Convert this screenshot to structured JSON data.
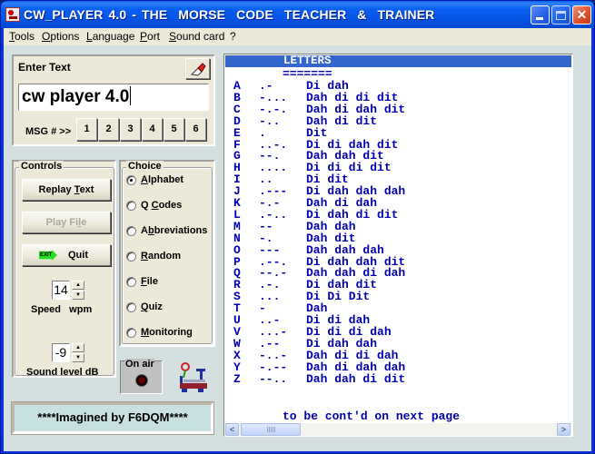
{
  "window": {
    "title": "CW_PLAYER 4.0 - THE  MORSE  CODE  TEACHER  &  TRAINER",
    "minimize_label": "Minimize",
    "maximize_label": "Maximize",
    "close_label": "Close"
  },
  "menu": [
    {
      "label": "Tools",
      "mnemonic": "T",
      "rest": "ools"
    },
    {
      "label": "Options",
      "mnemonic": "O",
      "rest": "ptions"
    },
    {
      "label": "Language",
      "mnemonic": "L",
      "rest": "anguage"
    },
    {
      "label": "Port",
      "mnemonic": "P",
      "rest": "ort"
    },
    {
      "label": "Sound card",
      "mnemonic": "S",
      "rest": "ound card"
    },
    {
      "label": "?",
      "mnemonic": "",
      "rest": "?"
    }
  ],
  "enter_text": {
    "label": "Enter Text",
    "value": "cw player 4.0",
    "erase_icon": "eraser-icon",
    "msg_label": "MSG # >>",
    "msg_buttons": [
      "1",
      "2",
      "3",
      "4",
      "5",
      "6"
    ]
  },
  "controls": {
    "label": "Controls",
    "replay": {
      "pre": "Replay ",
      "mnemonic": "T",
      "post": "ext"
    },
    "play_file": {
      "pre": "Play Fi",
      "mnemonic": "l",
      "post": "e",
      "disabled": true
    },
    "quit": {
      "label": "Quit",
      "icon": "exit-icon",
      "icon_text": "EXIT"
    },
    "speed": {
      "value": "14",
      "label": "Speed   wpm"
    },
    "sound_level": {
      "value": "-9",
      "label": "Sound level dB"
    },
    "spin_up": "▲",
    "spin_down": "▼"
  },
  "choice": {
    "label": "Choice",
    "selected": "Alphabet",
    "options": [
      {
        "pre": "",
        "mnemonic": "A",
        "post": "lphabet",
        "checked": true
      },
      {
        "pre": "Q ",
        "mnemonic": "C",
        "post": "odes",
        "checked": false
      },
      {
        "pre": "A",
        "mnemonic": "b",
        "post": "breviations",
        "checked": false
      },
      {
        "pre": "",
        "mnemonic": "R",
        "post": "andom",
        "checked": false
      },
      {
        "pre": "",
        "mnemonic": "F",
        "post": "ile",
        "checked": false
      },
      {
        "pre": "",
        "mnemonic": "Q",
        "post": "uiz",
        "checked": false
      },
      {
        "pre": "",
        "mnemonic": "M",
        "post": "onitoring",
        "checked": false
      }
    ]
  },
  "on_air": {
    "label": "On air",
    "state": "off"
  },
  "credit": "****Imagined by F6DQM****",
  "morse_pane": {
    "header": "LETTERS",
    "underline": "=======",
    "rows": [
      {
        "letter": "A",
        "code": ".-",
        "words": "Di dah"
      },
      {
        "letter": "B",
        "code": "-...",
        "words": "Dah di di dit"
      },
      {
        "letter": "C",
        "code": "-.-.",
        "words": "Dah di dah dit"
      },
      {
        "letter": "D",
        "code": "-..",
        "words": "Dah di dit"
      },
      {
        "letter": "E",
        "code": ".",
        "words": "Dit"
      },
      {
        "letter": "F",
        "code": "..-.",
        "words": "Di di dah dit"
      },
      {
        "letter": "G",
        "code": "--.",
        "words": "Dah dah dit"
      },
      {
        "letter": "H",
        "code": "....",
        "words": "Di di di dit"
      },
      {
        "letter": "I",
        "code": "..",
        "words": "Di dit"
      },
      {
        "letter": "J",
        "code": ".---",
        "words": "Di dah dah dah"
      },
      {
        "letter": "K",
        "code": "-.-",
        "words": "Dah di dah"
      },
      {
        "letter": "L",
        "code": ".-..",
        "words": "Di dah di dit"
      },
      {
        "letter": "M",
        "code": "--",
        "words": "Dah dah"
      },
      {
        "letter": "N",
        "code": "-.",
        "words": "Dah dit"
      },
      {
        "letter": "O",
        "code": "---",
        "words": "Dah dah dah"
      },
      {
        "letter": "P",
        "code": ".--.",
        "words": "Di dah dah dit"
      },
      {
        "letter": "Q",
        "code": "--.-",
        "words": "Dah dah di dah"
      },
      {
        "letter": "R",
        "code": ".-.",
        "words": "Di dah dit"
      },
      {
        "letter": "S",
        "code": "...",
        "words": "Di Di Dit"
      },
      {
        "letter": "T",
        "code": "-",
        "words": "Dah"
      },
      {
        "letter": "U",
        "code": "..-",
        "words": "Di di dah"
      },
      {
        "letter": "V",
        "code": "...-",
        "words": "Di di di dah"
      },
      {
        "letter": "W",
        "code": ".--",
        "words": "Di dah dah"
      },
      {
        "letter": "X",
        "code": "-..-",
        "words": "Dah di di dah"
      },
      {
        "letter": "Y",
        "code": "-.--",
        "words": "Dah di dah dah"
      },
      {
        "letter": "Z",
        "code": "--..",
        "words": "Dah dah di dit"
      }
    ],
    "footer": "to be cont'd on next page",
    "scroll_left": "<",
    "scroll_right": ">"
  }
}
